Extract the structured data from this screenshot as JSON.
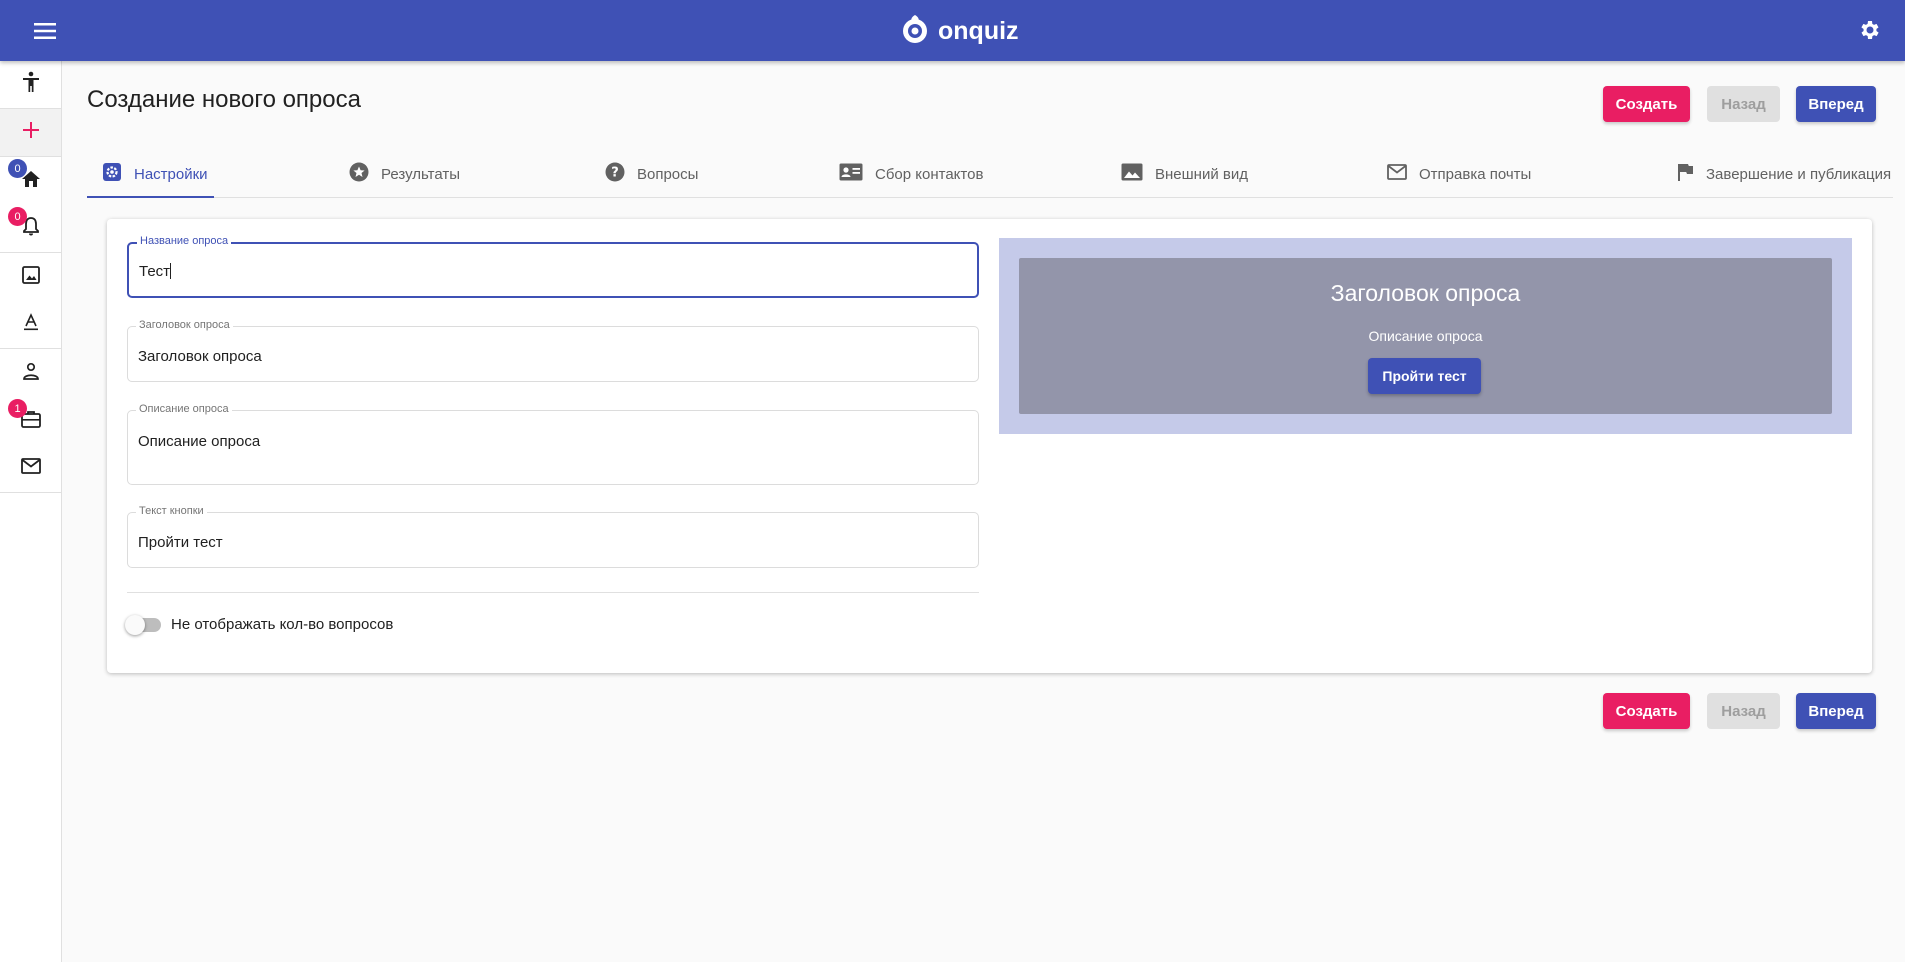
{
  "app": {
    "brand": "onquiz"
  },
  "colors": {
    "primary": "#3f51b5",
    "accent": "#e91e63",
    "disabled": "#e0e0e0",
    "preview_outer": "#c5cae9",
    "preview_inner": "#9395aa"
  },
  "topbar": {
    "menu_icon": "menu-icon",
    "logo_icon": "onquiz-logo-icon",
    "settings_icon": "gear-icon"
  },
  "sidebar": {
    "items": [
      {
        "icon": "accessibility-icon"
      },
      {
        "icon": "plus-icon",
        "active": true
      },
      {
        "icon": "home-icon",
        "badge": "0"
      },
      {
        "icon": "bell-icon",
        "badge": "0"
      },
      {
        "icon": "image-icon"
      },
      {
        "icon": "text-format-icon"
      },
      {
        "icon": "person-icon"
      },
      {
        "icon": "briefcase-icon",
        "badge": "1"
      },
      {
        "icon": "mail-icon"
      }
    ]
  },
  "page": {
    "title": "Создание нового опроса"
  },
  "actions": {
    "create": "Создать",
    "back": "Назад",
    "forward": "Вперед"
  },
  "tabs": [
    {
      "label": "Настройки",
      "icon": "settings-box-icon",
      "active": true
    },
    {
      "label": "Результаты",
      "icon": "star-circle-icon"
    },
    {
      "label": "Вопросы",
      "icon": "help-circle-icon"
    },
    {
      "label": "Сбор контактов",
      "icon": "contact-card-icon"
    },
    {
      "label": "Внешний вид",
      "icon": "image-icon"
    },
    {
      "label": "Отправка почты",
      "icon": "mail-icon"
    },
    {
      "label": "Завершение и публикация",
      "icon": "flag-icon"
    }
  ],
  "form": {
    "name": {
      "label": "Название опроса",
      "value": "Тест"
    },
    "heading": {
      "label": "Заголовок опроса",
      "value": "Заголовок опроса"
    },
    "description": {
      "label": "Описание опроса",
      "value": "Описание опроса"
    },
    "button_text": {
      "label": "Текст кнопки",
      "value": "Пройти тест"
    },
    "hide_count": {
      "label": "Не отображать кол-во вопросов",
      "checked": false
    }
  },
  "preview": {
    "title": "Заголовок опроса",
    "description": "Описание опроса",
    "button": "Пройти тест"
  }
}
